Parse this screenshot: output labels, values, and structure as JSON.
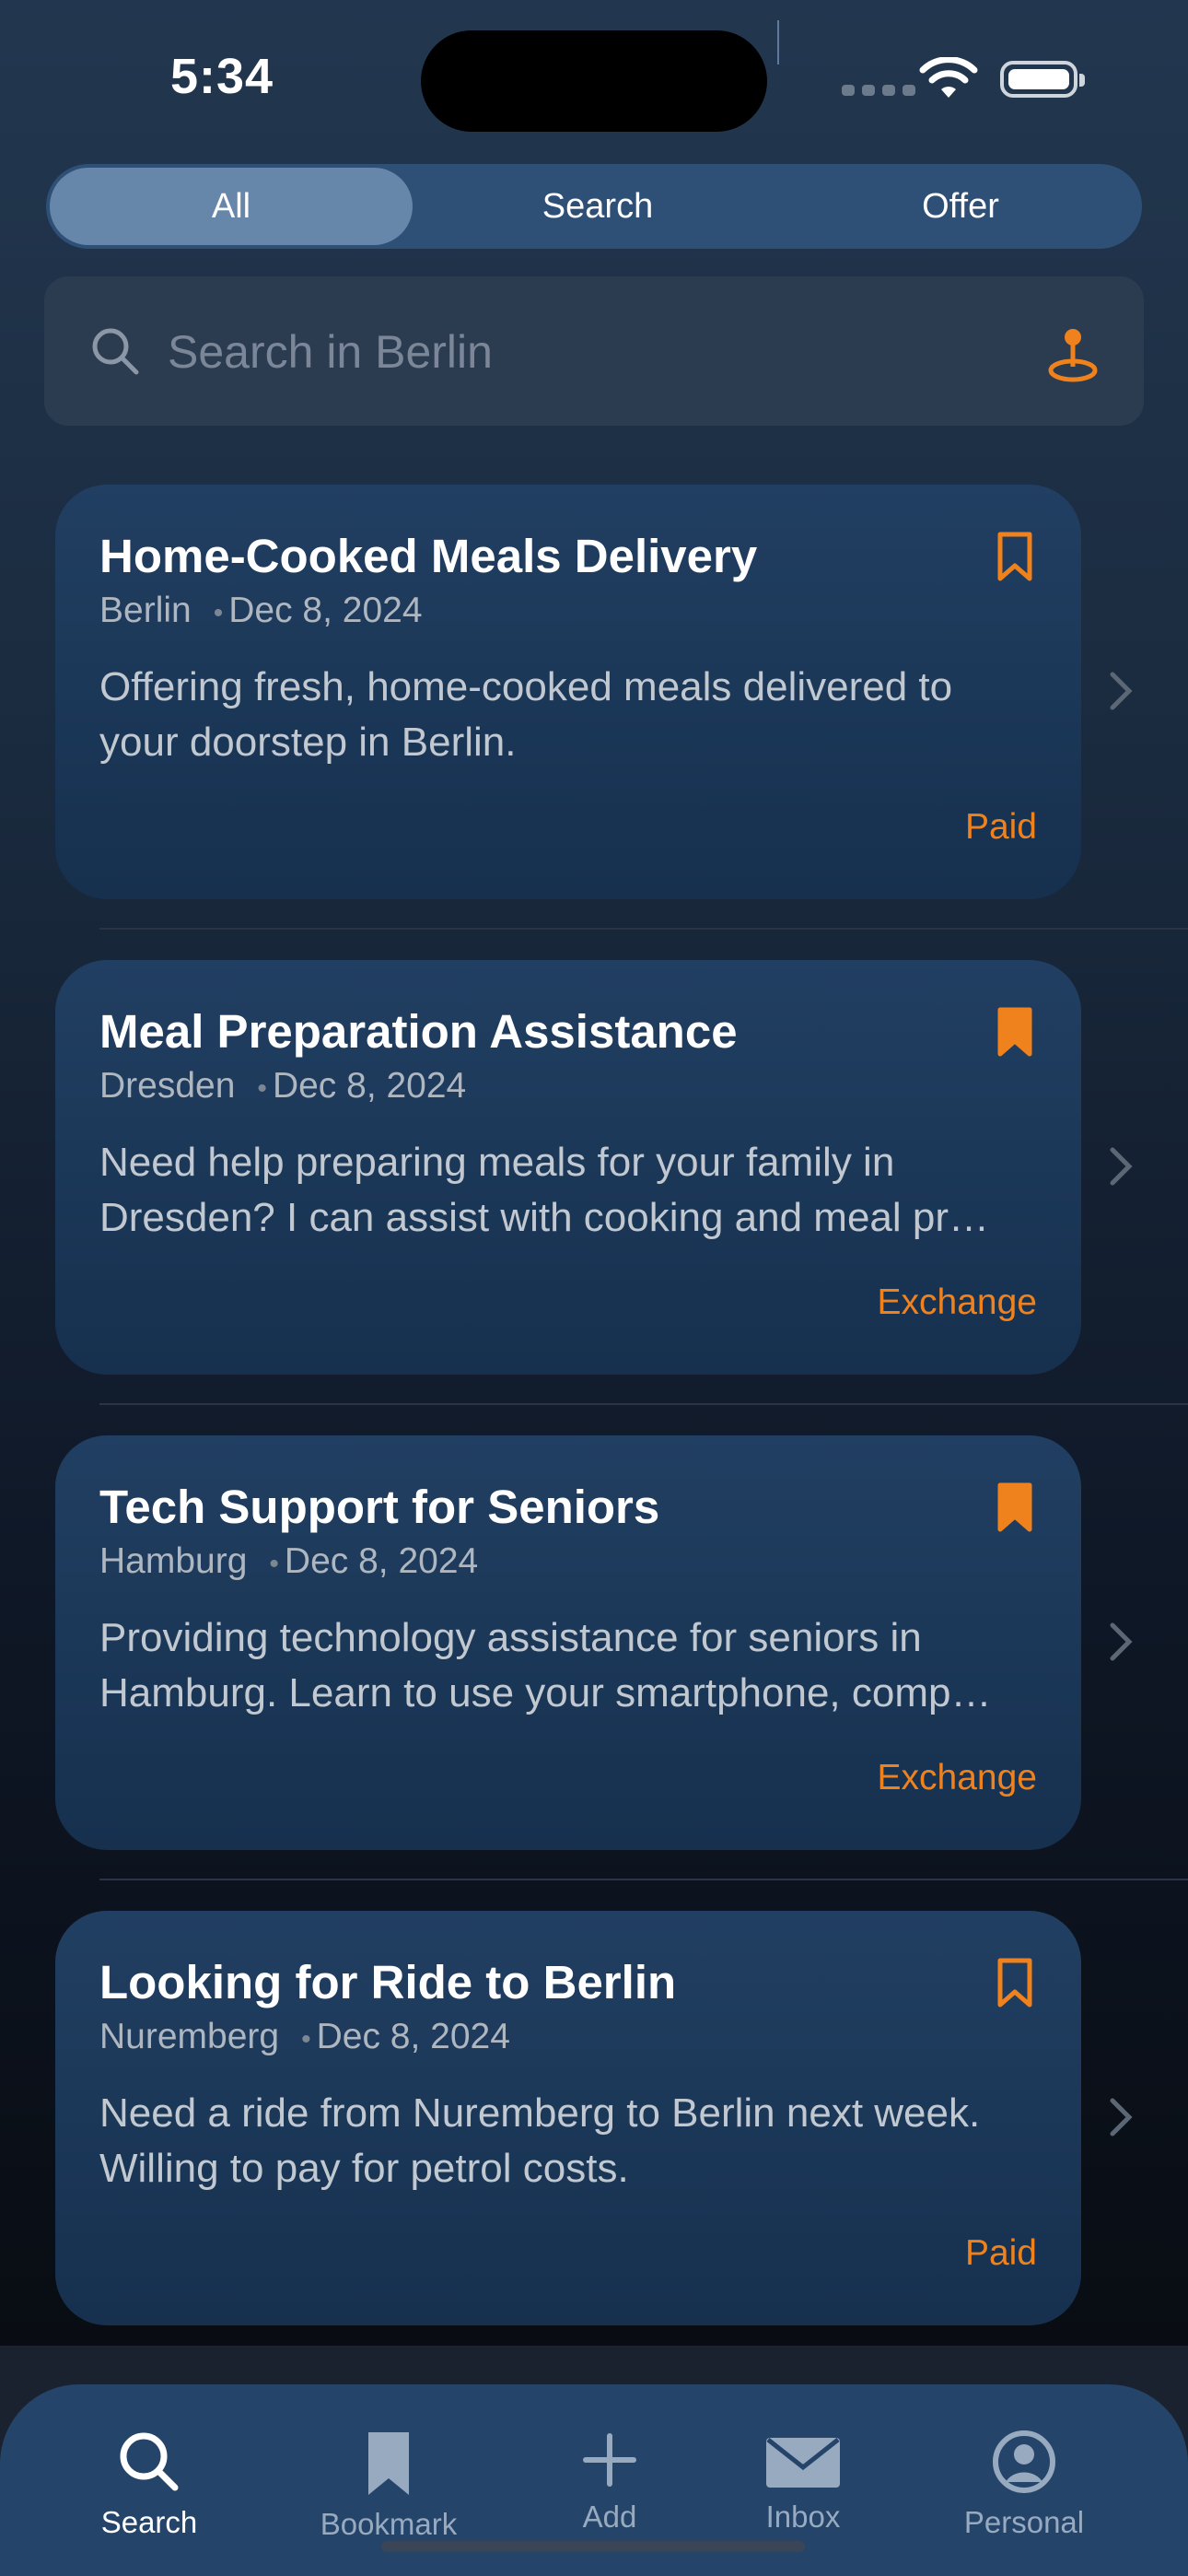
{
  "status": {
    "time": "5:34"
  },
  "segments": [
    {
      "label": "All",
      "active": true
    },
    {
      "label": "Search",
      "active": false
    },
    {
      "label": "Offer",
      "active": false
    }
  ],
  "search": {
    "placeholder": "Search in Berlin"
  },
  "colors": {
    "accent": "#f0821e",
    "card": "#1c3a5c",
    "tab_bar": "#244469"
  },
  "listings": [
    {
      "title": "Home-Cooked Meals Delivery",
      "city": "Berlin",
      "date": "Dec 8, 2024",
      "desc_line1": "Offering fresh, home-cooked meals delivered to",
      "desc_line2": "your doorstep in Berlin.",
      "tag": "Paid",
      "bookmarked": false
    },
    {
      "title": "Meal Preparation Assistance",
      "city": "Dresden",
      "date": "Dec 8, 2024",
      "desc_line1": "Need help preparing meals for your family in",
      "desc_line2": "Dresden? I can assist with cooking and meal pr…",
      "tag": "Exchange",
      "bookmarked": true
    },
    {
      "title": "Tech Support for Seniors",
      "city": "Hamburg",
      "date": "Dec 8, 2024",
      "desc_line1": "Providing technology assistance for seniors in",
      "desc_line2": "Hamburg. Learn to use your smartphone, comp…",
      "tag": "Exchange",
      "bookmarked": true
    },
    {
      "title": "Looking for Ride to Berlin",
      "city": "Nuremberg",
      "date": "Dec 8, 2024",
      "desc_line1": "Need a ride from Nuremberg to Berlin next week.",
      "desc_line2": "Willing to pay for petrol costs.",
      "tag": "Paid",
      "bookmarked": false
    }
  ],
  "tabs": [
    {
      "label": "Search",
      "icon": "search-icon",
      "active": true
    },
    {
      "label": "Bookmark",
      "icon": "bookmark-icon",
      "active": false
    },
    {
      "label": "Add",
      "icon": "plus-icon",
      "active": false
    },
    {
      "label": "Inbox",
      "icon": "envelope-icon",
      "active": false
    },
    {
      "label": "Personal",
      "icon": "person-icon",
      "active": false
    }
  ]
}
